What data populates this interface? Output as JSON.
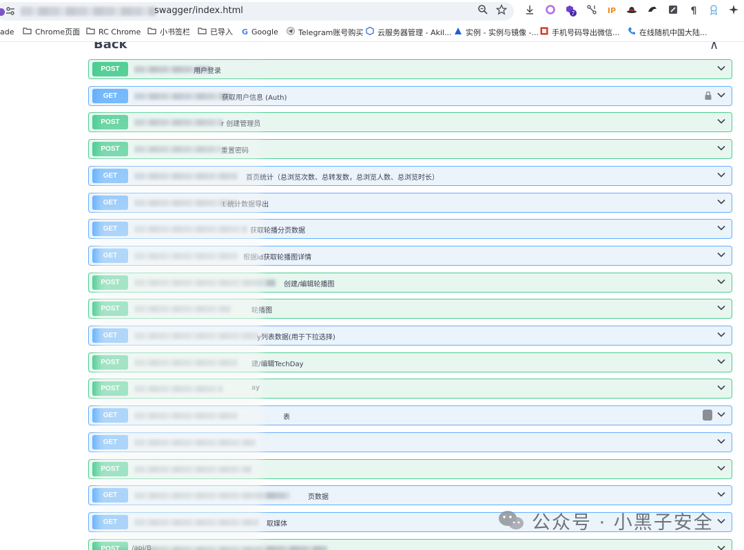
{
  "browser": {
    "url_visible": "swagger/index.html",
    "bookmarks": [
      {
        "label": "ade",
        "icon": ""
      },
      {
        "label": "Chrome页面",
        "icon": "folder-icon"
      },
      {
        "label": "RC Chrome",
        "icon": "folder-icon"
      },
      {
        "label": "小书签栏",
        "icon": "folder-icon"
      },
      {
        "label": "已导入",
        "icon": "folder-icon"
      },
      {
        "label": "Google",
        "icon": "google-icon"
      },
      {
        "label": "Telegram账号购买",
        "icon": "telegram-icon"
      },
      {
        "label": "云服务器管理 - Akil...",
        "icon": "cloud-icon"
      },
      {
        "label": "实例 - 实例与镜像 -...",
        "icon": "triangle-icon"
      },
      {
        "label": "手机号码导出微信...",
        "icon": "image-icon"
      },
      {
        "label": "在线随机中国大陆...",
        "icon": "phone-icon"
      }
    ],
    "extension_badge": "7"
  },
  "section": {
    "title": "Back",
    "collapse_glyph": "∧"
  },
  "operations": [
    {
      "method": "POST",
      "summary": "用户登录",
      "icon": ""
    },
    {
      "method": "GET",
      "summary": "获取用户信息 (Auth)",
      "icon": "lock-icon"
    },
    {
      "method": "POST",
      "summary": "r  创建管理员",
      "icon": ""
    },
    {
      "method": "POST",
      "summary": "重置密码",
      "icon": ""
    },
    {
      "method": "GET",
      "summary": "首页统计（总浏览次数、总转发数，总浏览人数、总浏览时长）",
      "icon": ""
    },
    {
      "method": "GET",
      "summary": "t  统计数据导出",
      "icon": ""
    },
    {
      "method": "GET",
      "summary": "获取轮播分页数据",
      "icon": ""
    },
    {
      "method": "GET",
      "summary": "根据id获取轮播图详情",
      "icon": ""
    },
    {
      "method": "POST",
      "summary": "创建/编辑轮播图",
      "icon": ""
    },
    {
      "method": "POST",
      "summary": "轮播图",
      "icon": ""
    },
    {
      "method": "GET",
      "summary": "y列表数据(用于下拉选择)",
      "icon": ""
    },
    {
      "method": "POST",
      "summary": "建/编辑TechDay",
      "icon": ""
    },
    {
      "method": "POST",
      "summary": "ay",
      "icon": ""
    },
    {
      "method": "GET",
      "summary": "表",
      "icon": "copy-icon"
    },
    {
      "method": "GET",
      "summary": "",
      "icon": ""
    },
    {
      "method": "POST",
      "summary": "",
      "icon": ""
    },
    {
      "method": "GET",
      "summary": "页数据",
      "icon": ""
    },
    {
      "method": "GET",
      "summary": "取媒体",
      "icon": ""
    },
    {
      "method": "POST",
      "summary": "/api/B",
      "icon": ""
    }
  ],
  "watermark": {
    "text": "公众号 · 小黑子安全"
  },
  "colors": {
    "post": "#49cc90",
    "get": "#61affe"
  }
}
